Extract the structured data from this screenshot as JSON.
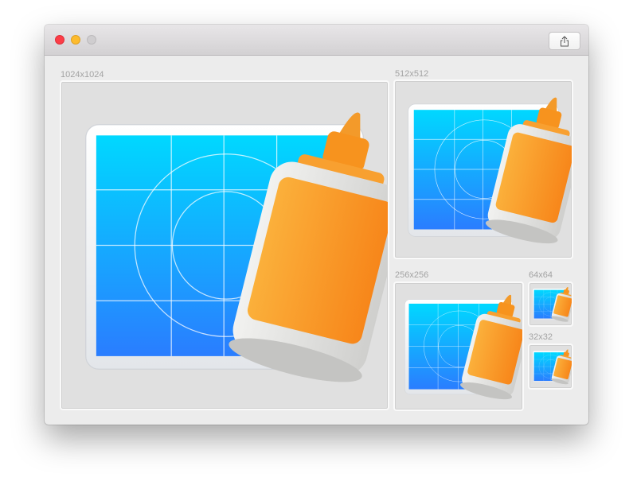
{
  "window": {
    "toolbar": {
      "share_icon": "share-icon"
    },
    "traffic_lights": {
      "close": "#fc3d47",
      "minimize": "#fdbb2d",
      "zoom": "#cfcdcf"
    }
  },
  "icon_wells": [
    {
      "label": "1024x1024"
    },
    {
      "label": "512x512"
    },
    {
      "label": "256x256"
    },
    {
      "label": "64x64"
    },
    {
      "label": "32x32"
    }
  ],
  "colors": {
    "blue_top": "#00d8ff",
    "blue_bottom": "#2a7dff",
    "orange_left": "#fbb03b",
    "orange_right": "#f7861a"
  }
}
